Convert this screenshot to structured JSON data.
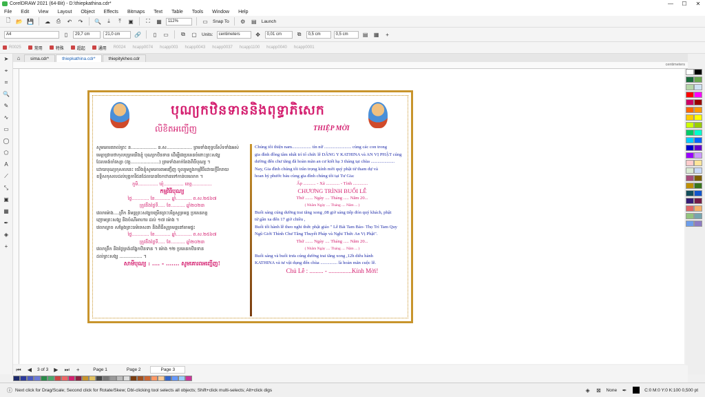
{
  "window": {
    "title": "CorelDRAW 2021 (64-Bit) - D:\\thiepkathina.cdr*",
    "min": "—",
    "max": "☐",
    "close": "✕"
  },
  "menu": [
    "File",
    "Edit",
    "View",
    "Layout",
    "Object",
    "Effects",
    "Bitmaps",
    "Text",
    "Table",
    "Tools",
    "Window",
    "Help"
  ],
  "toolbar1": {
    "zoom": "112%",
    "snap": "Snap To",
    "launch": "Launch"
  },
  "toolbar2": {
    "page_size": "A4",
    "width": "29,7 cm",
    "height": "21,0 cm",
    "units_label": "Units:",
    "units": "centimeters",
    "nudge": "0,01 cm",
    "dup_x": "0,5 cm",
    "dup_y": "0,5 cm"
  },
  "toolbar3": {
    "items": [
      "R0025",
      "常用",
      "特殊",
      "超起",
      "通用",
      "R0024",
      "hcapp0074",
      "hcapp003",
      "hcapp0043",
      "hcapp0037",
      "hcapp1100",
      "hcapp0040",
      "hcapp0001"
    ]
  },
  "tabs": [
    "sima.cdr*",
    "thiepkathina.cdr*",
    "thiepitykheo.cdr"
  ],
  "ruler": {
    "unit": "centimeters"
  },
  "pages": {
    "counter": "3  of  3",
    "page1": "Page 1",
    "page2": "Page 2",
    "page3": "Page 3"
  },
  "status": {
    "hint": "Next click for Drag/Scale; Second click for Rotate/Skew; Dbl-clicking tool selects all objects; Shift+click multi-selects; Alt+click digs",
    "fill": "None",
    "outline": "C:0 M:0 Y:0 K:100  0,500 pt"
  },
  "card": {
    "title_km": "បុណ្យកឋិនទាននិងពុទ្ធាភិសេក",
    "sub_km": "លិខិតអញ្ជើញ",
    "sub_vn": "THIỆP MỜI",
    "left": [
      "សូមគោរពរាល់ព្រះ ន.................. ន.ស.................. ព្រមទាំងពុទ្ធបរិស័ទទាំងអស់",
      "មេត្តាជ្រាបថាកុលបុត្រយើងខ្ញុំ  បុណ្យកឋិនទាន  ដើម្បីវេរប្រគេនចំពោះព្រះសង្ឃ",
      "ដែលគង់ចាំវស្សា (វត្ត....................) ព្រមទាំងតាក់តែងពិធីបុណ្យ ។",
      "ដោយបុណ្យកុសលនេះ យើងខ្ញុំសូមគោរពអញ្ជើញ ចូលរួមក្នុងកម្មវិធីដោយក្តីរីករាយ",
      "ឧទ្ទិសកុសលដល់បុព្វការីជនដែលបានចែកឋានទៅកាន់បរលោក ។",
      "ភូមិ.............. ឃុំ.............. ខេត្ត..............",
      "កម្មវិធីបុណ្យ",
      "ថ្ងៃ............ ខែ........... ឆ្នាំ........... ព.ស.២៥៦៧",
      "ត្រូវនឹងថ្ងៃទី..... ខែ.......... ឆ្នាំ២០២៣",
      "វេលាម៉ោង....ព្រឹក និមន្តព្រះសង្ឃចម្រើនព្រះបរិត្តសូត្រមន្ត ប្រគេនភត្ត",
      "ញោមព្រះសង្ឃ និងចំណីអាហារ ដល់ ១៧ ម៉ោង ។",
      "វេលាល្ងាច សម្តែងព្រះធម៌ទេសនា និងពិធីសូត្រមន្តនៅតាមផ្ទះ",
      "ថ្ងៃ............ ខែ........... ឆ្នាំ........... ព.ស.២៥៦៧",
      "ត្រូវនឹងថ្ងៃទី..... ខែ.......... ឆ្នាំ២០២៣",
      "វេលាព្រឹក និងថ្ងៃត្រង់ដង្ហែកឋិនទាន ។ ម៉ោង ១២ ប្រគេនកឋិនទាន",
      "ដល់ព្រះសង្ឃ ................ ។",
      "សាមីបុណ្យ : .... - ....... សូមគោរពអញ្ជើញ!"
    ],
    "right": [
      "Chúng tôi thiện nam................. tín nữ ........................ cùng các con trong",
      "gia đình đồng tâm nhất trí tổ chức lễ  DÂNG Y KATHINA và  AN VỊ PHẬT cúng",
      "dường đến chư tăng đã hoàn mãn an cư kiết hạ 3 tháng tại chùa .....................",
      "Nay, Gia đình chúng tôi trân trọng kính mời quý phật tử tham dự và",
      "hoan hỷ phước báu cùng gia đình chúng tôi tại Tư Gia:",
      "Ấp ........... - Xã ............ - Tỉnh .............",
      "CHƯƠNG TRÌNH BUỔI LỄ",
      "Thứ ....... Ngày .... Tháng ..... Năm 20...",
      "( Nhằm Ngày .... Tháng .... Năm ... )",
      "Buổi sáng cúng dường trai tăng xong ,08 giờ sáng tiếp đón quý khách,  phật",
      "tử gần xa đến 17 giờ chiều ,",
      "Buổi tối hành lễ theo nghi thức phật giáo \" Lễ Bái Tam Bảo- Thọ Trì Tam Quy",
      "Ngũ Giới Thỉnh Chư Tăng Thuyết Pháp và Nghi Thức An Vị Phật\".",
      "Thứ ....... Ngày .... Tháng ..... Năm 20...",
      "( Nhằm Ngày .... Tháng .... Năm ... )",
      "Buổi sáng và buổi trưa cúng dường trai tăng xong ,12h diễu hành",
      "KATHINA và tư vật dụng đến chùa ............... là hoàn mãn cuộc lễ.",
      "Chủ Lễ : ......... - ...............Kính Mời!"
    ]
  },
  "colors": {
    "palette": [
      "#ffffff",
      "#000000",
      "#1a6b3a",
      "#6aa84f",
      "#b6d7a8",
      "#cfe2f3",
      "#ff0000",
      "#ff00ff",
      "#cc0066",
      "#990000",
      "#ff6600",
      "#ff9900",
      "#ffcc00",
      "#ffff00",
      "#ccff00",
      "#99cc00",
      "#00cc66",
      "#00ffcc",
      "#00ccff",
      "#0066ff",
      "#0000cc",
      "#6600cc",
      "#9900ff",
      "#cc99ff",
      "#ffcccc",
      "#ffe599",
      "#d9ead3",
      "#c9daf8",
      "#a64d79",
      "#7f6000",
      "#bf9000",
      "#38761d",
      "#134f5c",
      "#1155cc",
      "#351c75",
      "#741b47",
      "#e06666",
      "#f6b26b",
      "#93c47d",
      "#76a5af",
      "#6d9eeb",
      "#8e7cc3"
    ],
    "colorbar": [
      "#1c2a6b",
      "#2b3a9b",
      "#4a5ac0",
      "#6a7ad8",
      "#2a8a4a",
      "#4aa86a",
      "#c44",
      "#e66",
      "#d42070",
      "#8a2040",
      "#c8942c",
      "#e0c060",
      "#444",
      "#777",
      "#999",
      "#bbb",
      "#ddd",
      "#7a3d10",
      "#a05020",
      "#cc6633",
      "#ff9966",
      "#ffcc99",
      "#3366cc",
      "#6699ff",
      "#99ccff",
      "#cc3399"
    ]
  }
}
